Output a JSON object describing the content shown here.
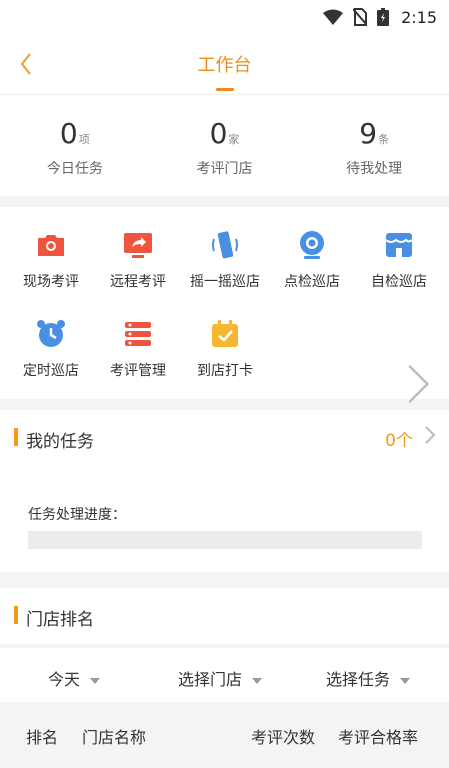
{
  "status": {
    "time": "2:15"
  },
  "header": {
    "title": "工作台"
  },
  "stats": [
    {
      "value": "0",
      "unit": "项",
      "label": "今日任务"
    },
    {
      "value": "0",
      "unit": "家",
      "label": "考评门店"
    },
    {
      "value": "9",
      "unit": "条",
      "label": "待我处理"
    }
  ],
  "grid": [
    {
      "label": "现场考评",
      "icon": "camera-icon",
      "color": "#f0533e"
    },
    {
      "label": "远程考评",
      "icon": "monitor-share-icon",
      "color": "#f0533e"
    },
    {
      "label": "摇一摇巡店",
      "icon": "phone-shake-icon",
      "color": "#4a90e2"
    },
    {
      "label": "点检巡店",
      "icon": "webcam-icon",
      "color": "#4a90e2"
    },
    {
      "label": "自检巡店",
      "icon": "store-icon",
      "color": "#4a90e2"
    },
    {
      "label": "定时巡店",
      "icon": "alarm-clock-icon",
      "color": "#4a90e2"
    },
    {
      "label": "考评管理",
      "icon": "list-icon",
      "color": "#f0533e"
    },
    {
      "label": "到店打卡",
      "icon": "calendar-check-icon",
      "color": "#f5b731"
    }
  ],
  "my_tasks": {
    "title": "我的任务",
    "count": "0个",
    "progress_label": "任务处理进度：",
    "progress": 0
  },
  "ranking": {
    "title": "门店排名",
    "filters": [
      "今天",
      "选择门店",
      "选择任务"
    ],
    "columns": [
      "排名",
      "门店名称",
      "考评次数",
      "考评合格率"
    ]
  },
  "colors": {
    "accent": "#f39a1e",
    "red": "#f0533e",
    "blue": "#4a90e2",
    "yellow": "#f5b731"
  }
}
